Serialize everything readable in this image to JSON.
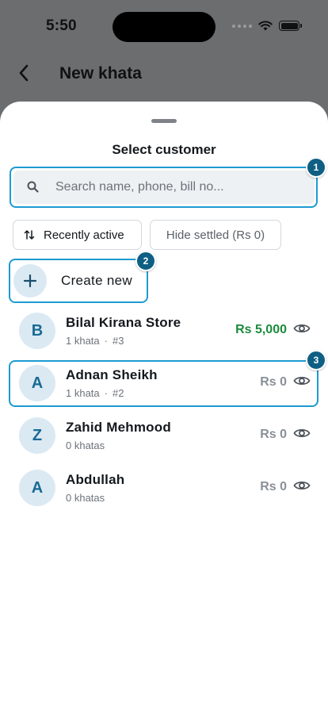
{
  "status_bar": {
    "time": "5:50"
  },
  "header": {
    "title": "New khata"
  },
  "sheet": {
    "title": "Select customer",
    "search": {
      "placeholder": "Search name, phone, bill no..."
    },
    "filters": {
      "sort_label": "Recently active",
      "hide_label": "Hide settled (Rs 0)"
    },
    "create_label": "Create new",
    "badges": [
      "1",
      "2",
      "3"
    ],
    "customers": [
      {
        "initial": "B",
        "name": "Bilal Kirana Store",
        "khatas": "1 khata",
        "ref": "#3",
        "amount": "Rs 5,000"
      },
      {
        "initial": "A",
        "name": "Adnan Sheikh",
        "khatas": "1 khata",
        "ref": "#2",
        "amount": "Rs 0"
      },
      {
        "initial": "Z",
        "name": "Zahid Mehmood",
        "khatas": "0 khatas",
        "ref": "",
        "amount": "Rs 0"
      },
      {
        "initial": "A",
        "name": "Abdullah",
        "khatas": "0 khatas",
        "ref": "",
        "amount": "Rs 0"
      }
    ]
  },
  "colors": {
    "accent": "#1d9bd1",
    "badge": "#0f5f84",
    "positive": "#1b8b3c",
    "muted": "#8a9097"
  },
  "icons": [
    "back-icon",
    "search-icon",
    "sort-icon",
    "plus-icon",
    "eye-icon",
    "wifi-icon",
    "battery-icon"
  ]
}
